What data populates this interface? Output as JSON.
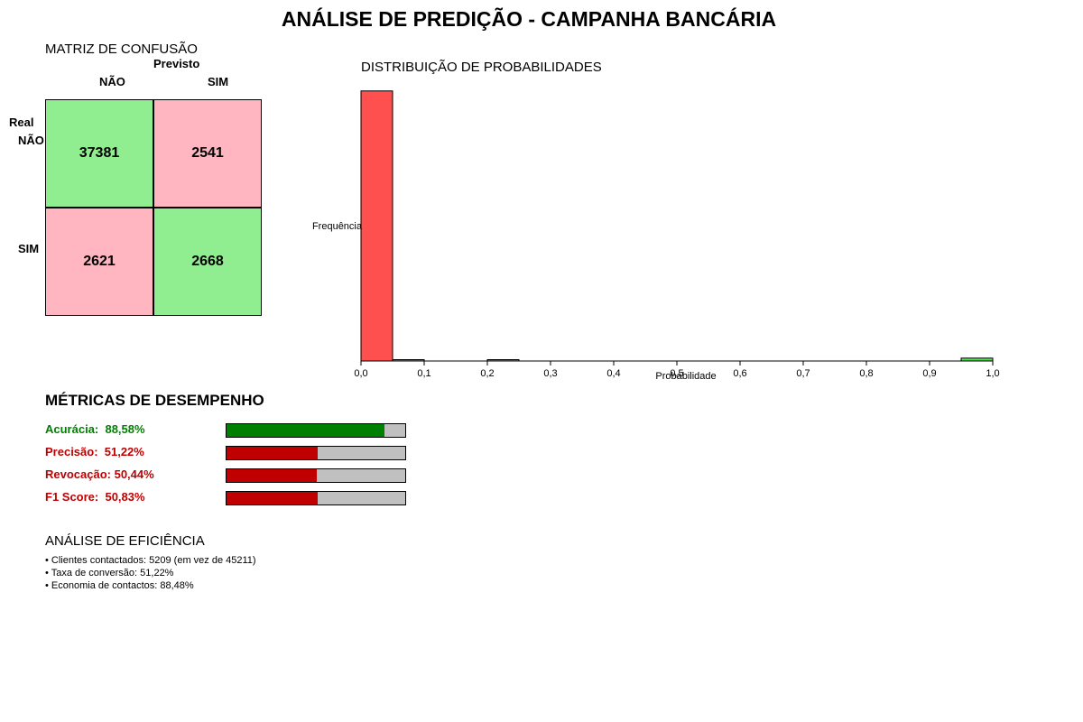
{
  "title": "ANÁLISE DE PREDIÇÃO - CAMPANHA BANCÁRIA",
  "confusion_matrix": {
    "title": "MATRIZ DE CONFUSÃO",
    "predicted_label": "Previsto",
    "real_label": "Real",
    "col_labels": [
      "NÃO",
      "SIM"
    ],
    "row_labels": [
      "NÃO",
      "SIM"
    ],
    "tn": "37381",
    "fp": "2541",
    "fn": "2621",
    "tp": "2668",
    "colors": {
      "correct": "#90ee90",
      "incorrect": "#ffb6c1"
    }
  },
  "metrics": {
    "title": "MÉTRICAS DE DESEMPENHO",
    "items": [
      {
        "label": "Acurácia:  88,58%",
        "value": 88.58,
        "color": "#008000"
      },
      {
        "label": "Precisão:  51,22%",
        "value": 51.22,
        "color": "#c00000"
      },
      {
        "label": "Revocação: 50,44%",
        "value": 50.44,
        "color": "#c00000"
      },
      {
        "label": "F1 Score:  50,83%",
        "value": 50.83,
        "color": "#c00000"
      }
    ],
    "track_color": "#c0c0c0"
  },
  "efficiency": {
    "title": "ANÁLISE DE EFICIÊNCIA",
    "lines": [
      "• Clientes contactados: 5209 (em vez de 45211)",
      "• Taxa de conversão: 51,22%",
      "• Economia de contactos: 88,48%"
    ]
  },
  "chart_data": {
    "type": "bar",
    "title": "DISTRIBUIÇÃO DE PROBABILIDADES",
    "xlabel": "Probabilidade",
    "ylabel": "Frequência",
    "xlim": [
      0,
      1
    ],
    "ylim": [
      0,
      39500
    ],
    "x_ticks": [
      "0,0",
      "0,1",
      "0,2",
      "0,3",
      "0,4",
      "0,5",
      "0,6",
      "0,7",
      "0,8",
      "0,9",
      "1,0"
    ],
    "bins": [
      {
        "start": 0.0,
        "end": 0.05,
        "value": 39400,
        "color": "#ff5050"
      },
      {
        "start": 0.05,
        "end": 0.1,
        "value": 150,
        "color": "#ff5050"
      },
      {
        "start": 0.2,
        "end": 0.25,
        "value": 130,
        "color": "#ff5050"
      },
      {
        "start": 0.95,
        "end": 1.0,
        "value": 420,
        "color": "#50e050"
      }
    ]
  }
}
